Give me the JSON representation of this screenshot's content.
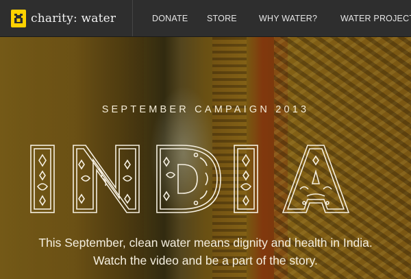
{
  "brand": {
    "name": "charity: water",
    "logo_icon": "jerrycan-icon",
    "accent": "#ffd200"
  },
  "nav": {
    "links": [
      {
        "label": "DONATE"
      },
      {
        "label": "STORE"
      },
      {
        "label": "WHY WATER?"
      },
      {
        "label": "WATER PROJECTS"
      }
    ]
  },
  "hero": {
    "eyebrow": "SEPTEMBER CAMPAIGN 2013",
    "headline": "INDIA",
    "tagline_line1": "This September, clean water means dignity and health in India.",
    "tagline_line2": "Watch the video and be a part of the story."
  }
}
